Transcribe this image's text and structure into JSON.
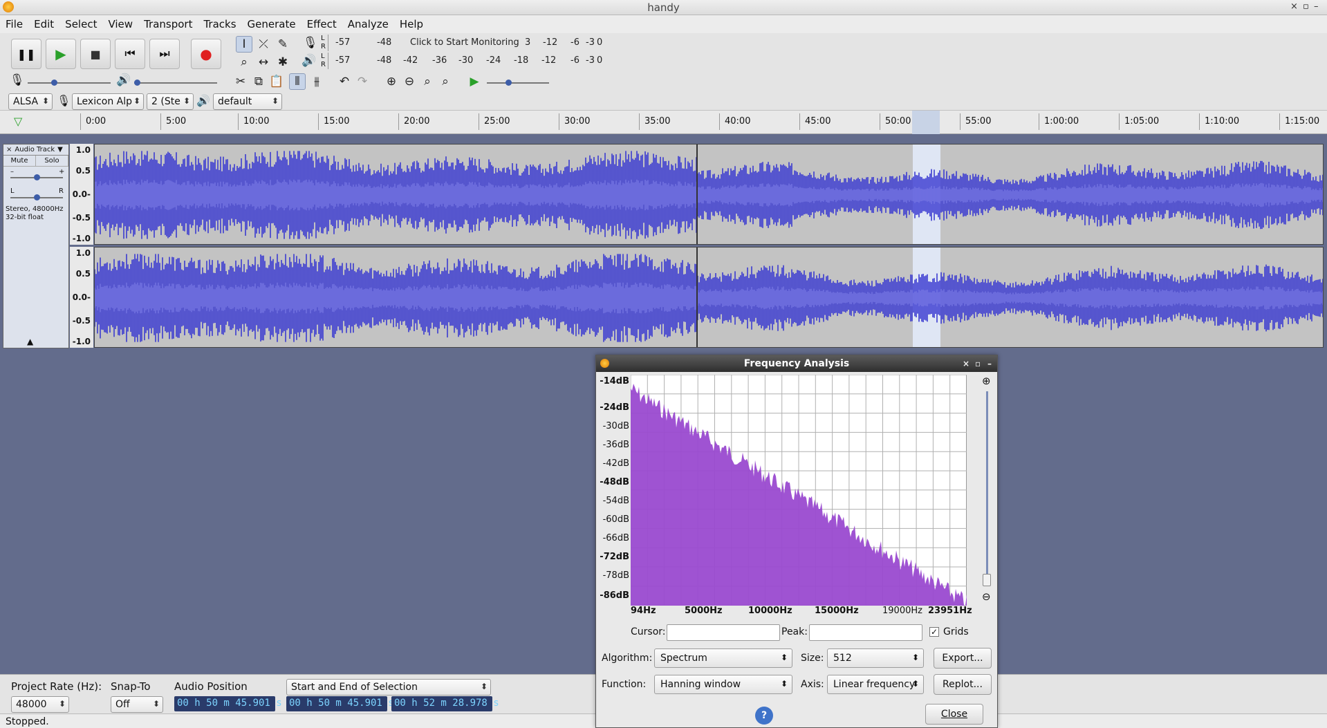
{
  "window": {
    "title": "handy",
    "controls": [
      "×",
      "▫",
      "–"
    ]
  },
  "menu": [
    "File",
    "Edit",
    "Select",
    "View",
    "Transport",
    "Tracks",
    "Generate",
    "Effect",
    "Analyze",
    "Help"
  ],
  "transport": {
    "pause": "❚❚",
    "play": "▶",
    "stop": "■",
    "skip_start": "⏮",
    "skip_end": "⏭",
    "record": "●"
  },
  "meters": {
    "record_ticks": [
      "-57",
      "-48",
      "Click to Start Monitoring",
      "3",
      "-12",
      "-6",
      "-3",
      "0"
    ],
    "play_ticks": [
      "-57",
      "-48",
      "-42",
      "-36",
      "-30",
      "-24",
      "-18",
      "-12",
      "-6",
      "-3",
      "0"
    ],
    "L": "L",
    "R": "R"
  },
  "device": {
    "host": "ALSA",
    "rec_device": "Lexicon Alp",
    "channels": "2 (Ste",
    "play_device": "default"
  },
  "ruler": [
    "0:00",
    "5:00",
    "10:00",
    "15:00",
    "20:00",
    "25:00",
    "30:00",
    "35:00",
    "40:00",
    "45:00",
    "50:00",
    "55:00",
    "1:00:00",
    "1:05:00",
    "1:10:00",
    "1:15:00"
  ],
  "track": {
    "name": "Audio Track",
    "mute": "Mute",
    "solo": "Solo",
    "gain_minus": "–",
    "gain_plus": "+",
    "pan_l": "L",
    "pan_r": "R",
    "info_line1": "Stereo, 48000Hz",
    "info_line2": "32-bit float",
    "scale": [
      "1.0",
      "0.5",
      "0.0-",
      "-0.5",
      "-1.0"
    ]
  },
  "bottom": {
    "project_rate_label": "Project Rate (Hz):",
    "project_rate": "48000",
    "snap_label": "Snap-To",
    "snap": "Off",
    "audio_pos_label": "Audio Position",
    "audio_pos": "00 h 50 m 45.901 s",
    "selection_mode": "Start and End of Selection",
    "sel_start": "00 h 50 m 45.901 s",
    "sel_end": "00 h 52 m 28.978 s"
  },
  "status": "Stopped.",
  "freq": {
    "title": "Frequency Analysis",
    "db_labels": [
      "-14dB",
      "-24dB",
      "-30dB",
      "-36dB",
      "-42dB",
      "-48dB",
      "-54dB",
      "-60dB",
      "-66dB",
      "-72dB",
      "-78dB",
      "-86dB"
    ],
    "hz_labels": [
      "94Hz",
      "5000Hz",
      "10000Hz",
      "15000Hz",
      "19000Hz",
      "23951Hz"
    ],
    "cursor_label": "Cursor:",
    "peak_label": "Peak:",
    "grids_label": "Grids",
    "grids_checked": "✓",
    "algorithm_label": "Algorithm:",
    "algorithm": "Spectrum",
    "size_label": "Size:",
    "size": "512",
    "export": "Export...",
    "function_label": "Function:",
    "function": "Hanning window",
    "axis_label": "Axis:",
    "axis": "Linear frequency",
    "replot": "Replot...",
    "help": "?",
    "close": "Close"
  },
  "colors": {
    "wave": "#3a3ad0",
    "wave_rms": "#6a6ae0",
    "spectrum": "#9a4ad0",
    "selection": "#dfe6f4"
  }
}
